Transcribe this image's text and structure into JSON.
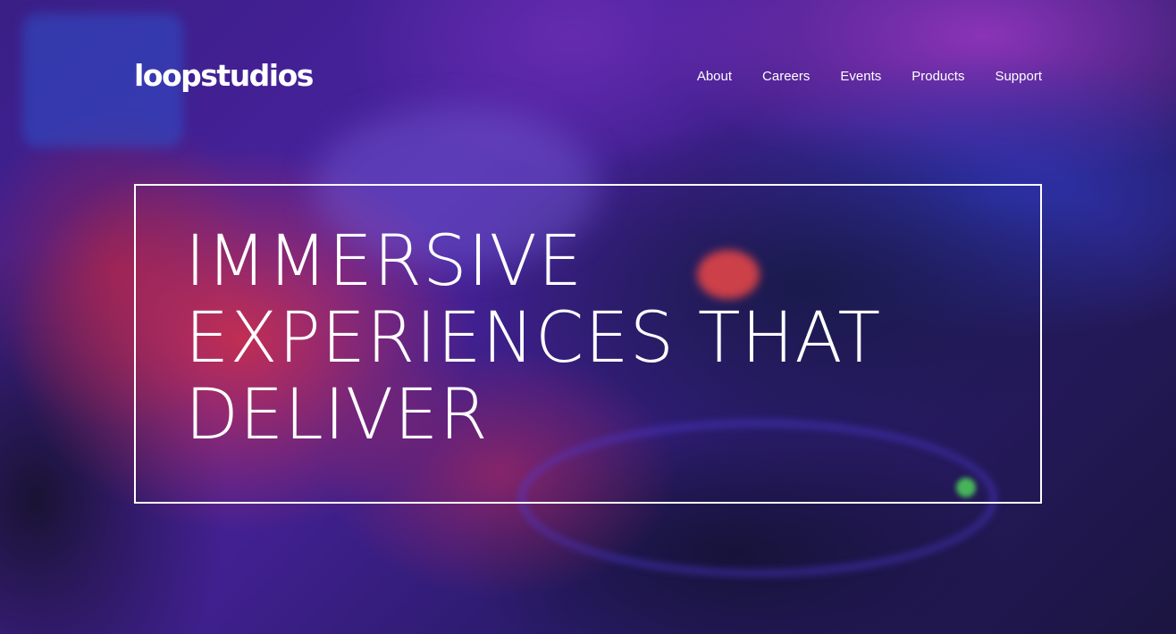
{
  "header": {
    "logo": "loopstudios",
    "nav": [
      "About",
      "Careers",
      "Events",
      "Products",
      "Support"
    ]
  },
  "hero": {
    "headline": "IMMERSIVE EXPERIENCES THAT DELIVER"
  },
  "colors": {
    "text": "#ffffff",
    "border": "#ffffff",
    "accent_purple": "#4a22a0",
    "accent_red": "#d63046",
    "accent_blue": "#2f38be"
  }
}
